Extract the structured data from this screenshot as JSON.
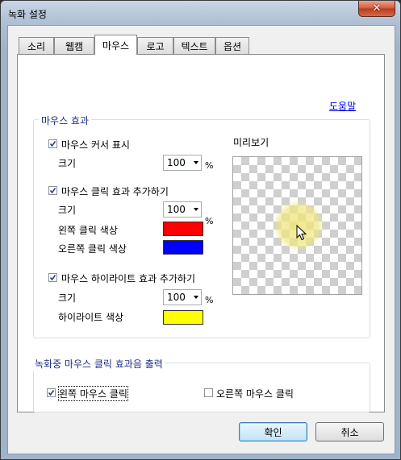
{
  "window": {
    "title": "녹화 설정",
    "close_label": "✕"
  },
  "tabs": [
    {
      "label": "소리"
    },
    {
      "label": "웹캠"
    },
    {
      "label": "마우스",
      "active": true
    },
    {
      "label": "로고"
    },
    {
      "label": "텍스트"
    },
    {
      "label": "옵션"
    }
  ],
  "help_link": "도움말",
  "mouse_effect": {
    "legend": "마우스 효과",
    "show_cursor": {
      "label": "마우스 커서 표시",
      "checked": true,
      "size_label": "크기",
      "size_value": "100",
      "unit": "%"
    },
    "click_effect": {
      "label": "마우스 클릭 효과 추가하기",
      "checked": true,
      "size_label": "크기",
      "size_value": "100",
      "unit": "%",
      "left_color_label": "왼쪽 클릭 색상",
      "left_color": "#ff0000",
      "right_color_label": "오른쪽 클릭 색상",
      "right_color": "#0000ff"
    },
    "highlight_effect": {
      "label": "마우스 하이라이트 효과 추가하기",
      "checked": true,
      "size_label": "크기",
      "size_value": "100",
      "unit": "%",
      "color_label": "하이라이트 색상",
      "color": "#ffff00"
    },
    "preview_label": "미리보기"
  },
  "recording_output": {
    "legend": "녹화중 마우스 클릭 효과음 출력",
    "left_click": {
      "label": "왼쪽 마우스 클릭",
      "checked": true
    },
    "right_click": {
      "label": "오른쪽 마우스 클릭",
      "checked": false
    }
  },
  "buttons": {
    "ok": "확인",
    "cancel": "취소"
  }
}
